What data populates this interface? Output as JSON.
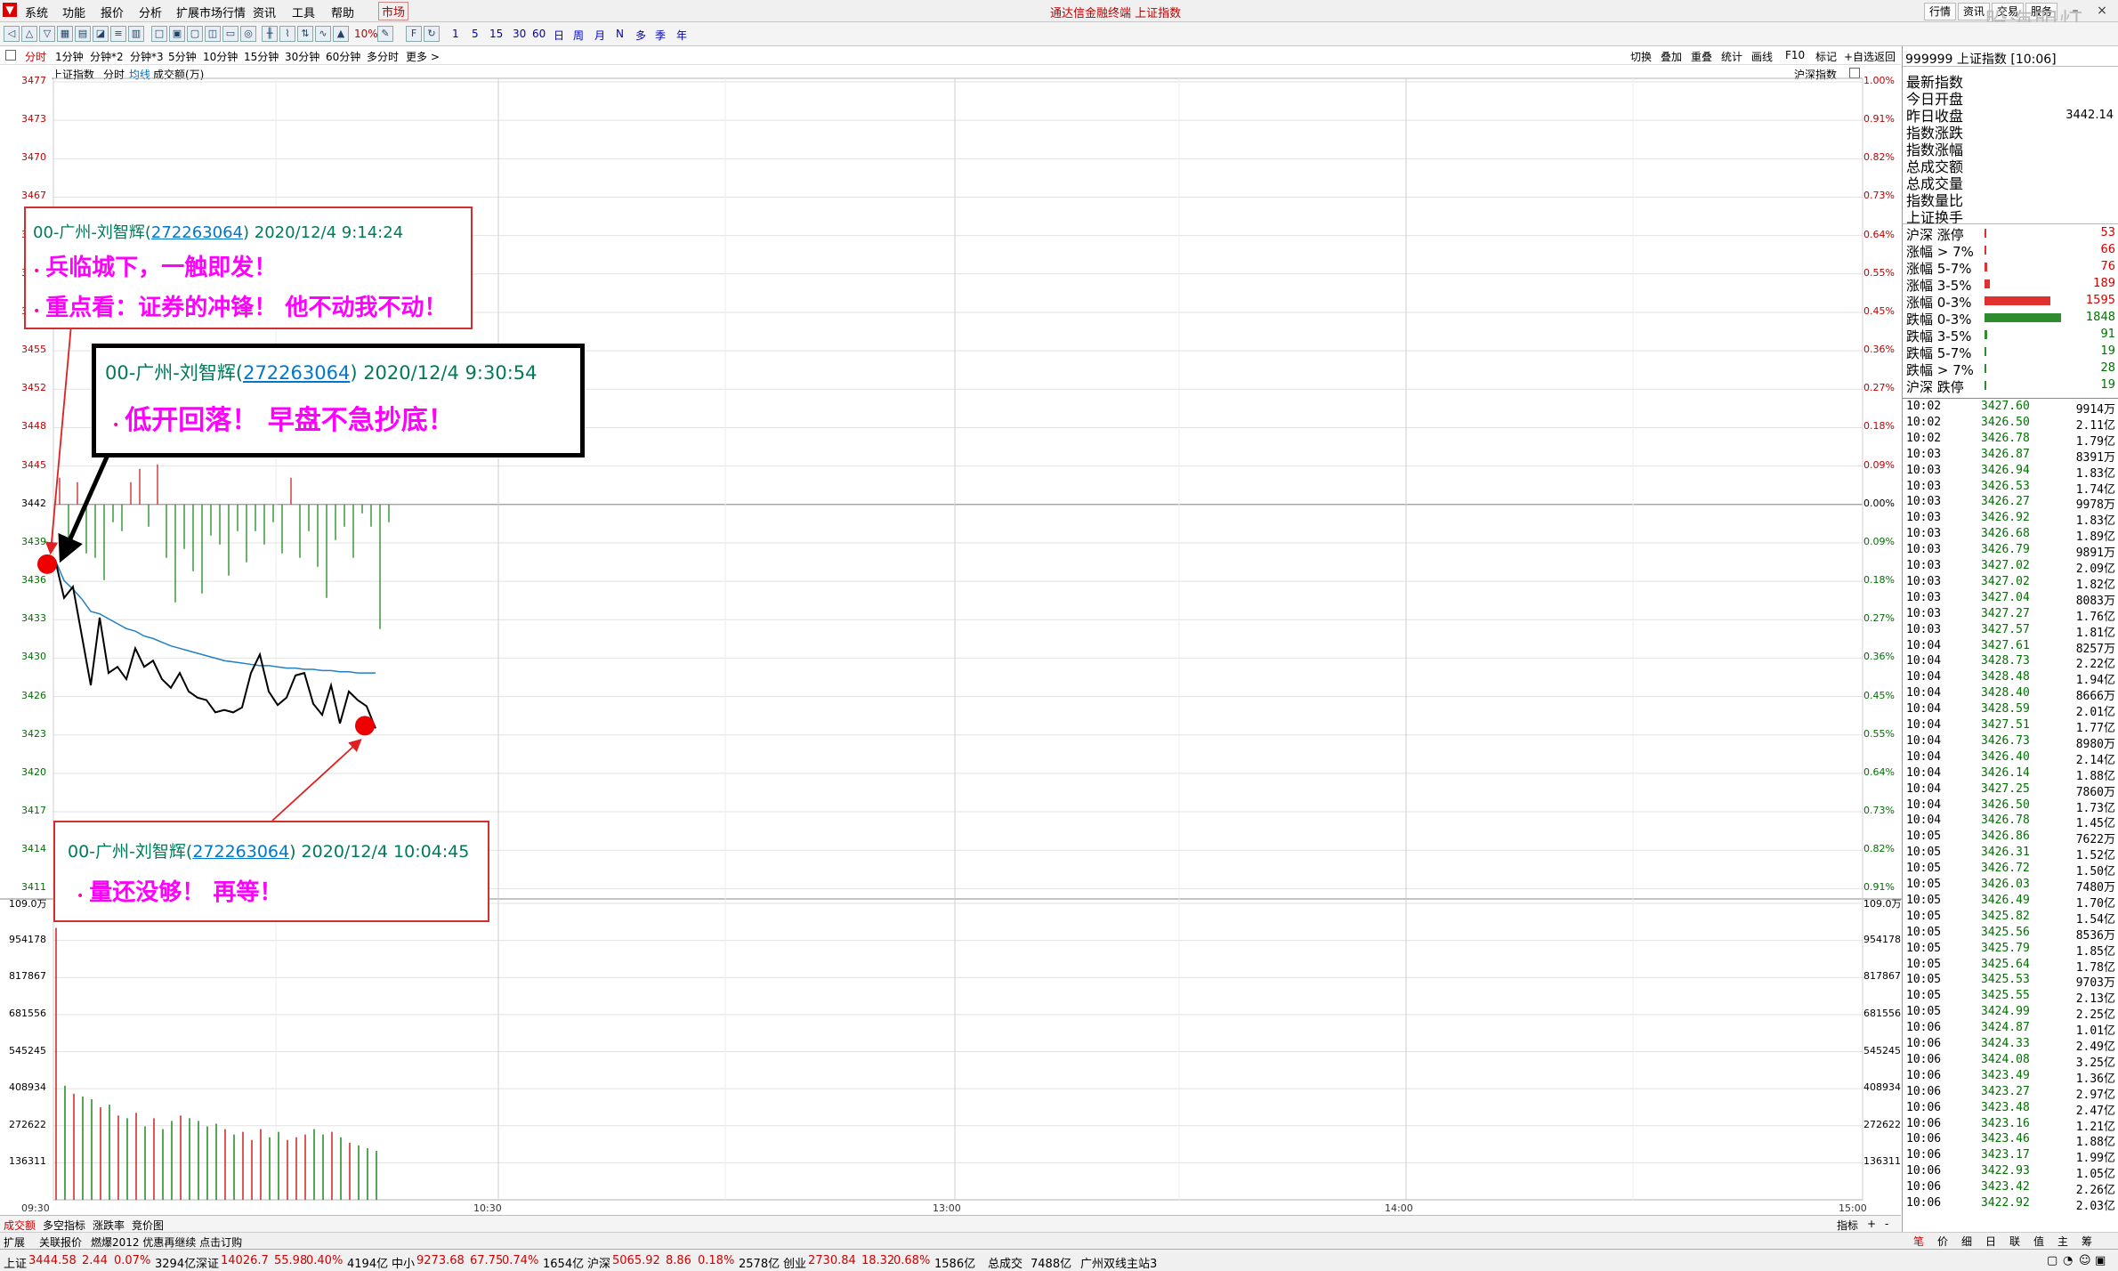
{
  "titlebar": {
    "menus": [
      "系统",
      "功能",
      "报价",
      "分析",
      "扩展市场行情",
      "资讯",
      "工具",
      "帮助"
    ],
    "market_tab": "市场",
    "title": "通达信金融终端 上证指数",
    "window_tabs": [
      "行情",
      "资讯",
      "交易",
      "服务"
    ],
    "watermark": "股海明灯"
  },
  "toolbar": {
    "zoom_label": "10%",
    "periods": [
      "1",
      "5",
      "15",
      "30",
      "60",
      "日",
      "周",
      "月",
      "N",
      "多",
      "季",
      "年"
    ]
  },
  "periodbar": {
    "items": [
      "分时",
      "1分钟",
      "分钟*2",
      "分钟*3",
      "5分钟",
      "10分钟",
      "15分钟",
      "30分钟",
      "60分钟",
      "多分时",
      "更多 >"
    ],
    "active": "分时",
    "right_tools": [
      "切换",
      "叠加",
      "重叠",
      "统计",
      "画线",
      "F10",
      "标记",
      "+自选",
      "返回"
    ]
  },
  "chart": {
    "sub_header": {
      "name": "上证指数",
      "mode": "分时",
      "avg": "均线",
      "volume_label": "成交额(万)",
      "right_label": "沪深指数"
    },
    "price_labels": [
      "3477",
      "3473",
      "3470",
      "3467",
      "3464",
      "3461",
      "3458",
      "3455",
      "3452",
      "3448",
      "3445",
      "3442",
      "3439",
      "3436",
      "3433",
      "3430",
      "3426",
      "3423",
      "3420",
      "3417",
      "3414",
      "3411"
    ],
    "pct_labels": [
      "1.00%",
      "0.91%",
      "0.82%",
      "0.73%",
      "0.64%",
      "0.55%",
      "0.45%",
      "0.36%",
      "0.27%",
      "0.18%",
      "0.09%",
      "0.00%",
      "0.09%",
      "0.18%",
      "0.27%",
      "0.36%",
      "0.45%",
      "0.55%",
      "0.64%",
      "0.73%",
      "0.82%",
      "0.91%"
    ],
    "vol_labels": [
      "109.0万",
      "954178",
      "817867",
      "681556",
      "545245",
      "408934",
      "272622",
      "136311"
    ],
    "time_labels": [
      "09:30",
      "10:30",
      "13:00",
      "14:00",
      "15:00"
    ]
  },
  "chart_data": {
    "type": "line",
    "title": "上证指数",
    "xlabel": "",
    "ylabel": "",
    "ylim": [
      3410,
      3477
    ],
    "prev_close": 3442.14,
    "x": [
      "09:30",
      "09:31",
      "09:32",
      "09:33",
      "09:34",
      "09:35",
      "09:36",
      "09:37",
      "09:38",
      "09:39",
      "09:40",
      "09:41",
      "09:42",
      "09:43",
      "09:44",
      "09:45",
      "09:46",
      "09:47",
      "09:48",
      "09:49",
      "09:50",
      "09:51",
      "09:52",
      "09:53",
      "09:54",
      "09:55",
      "09:56",
      "09:57",
      "09:58",
      "09:59",
      "10:00",
      "10:01",
      "10:02",
      "10:03",
      "10:04",
      "10:05",
      "10:06"
    ],
    "series": [
      {
        "name": "价格",
        "values": [
          3438.2,
          3435.1,
          3436.0,
          3432.0,
          3428.0,
          3433.5,
          3429.0,
          3429.5,
          3428.5,
          3431.0,
          3429.5,
          3430.0,
          3428.5,
          3427.8,
          3429.0,
          3427.5,
          3427.0,
          3426.8,
          3425.8,
          3426.0,
          3425.8,
          3426.2,
          3429.0,
          3430.5,
          3427.5,
          3426.4,
          3427.0,
          3428.8,
          3429.0,
          3426.5,
          3425.6,
          3428.0,
          3424.9,
          3427.5,
          3426.8,
          3426.3,
          3424.5
        ]
      },
      {
        "name": "均价",
        "values": [
          3438.2,
          3436.5,
          3435.8,
          3435.0,
          3434.0,
          3433.8,
          3433.4,
          3433.0,
          3432.6,
          3432.4,
          3432.0,
          3431.8,
          3431.5,
          3431.2,
          3431.0,
          3430.8,
          3430.6,
          3430.4,
          3430.2,
          3430.0,
          3429.9,
          3429.8,
          3429.7,
          3429.6,
          3429.6,
          3429.5,
          3429.4,
          3429.4,
          3429.3,
          3429.3,
          3429.2,
          3429.2,
          3429.1,
          3429.1,
          3429.0,
          3429.0,
          3429.0
        ]
      }
    ],
    "volume": [
      1000000,
      420000,
      390000,
      380000,
      370000,
      340000,
      350000,
      310000,
      300000,
      320000,
      270000,
      300000,
      260000,
      290000,
      310000,
      300000,
      290000,
      270000,
      280000,
      260000,
      240000,
      250000,
      220000,
      260000,
      230000,
      250000,
      220000,
      230000,
      240000,
      260000,
      240000,
      250000,
      230000,
      210000,
      200000,
      190000,
      180000
    ],
    "vol_ylim": [
      0,
      1090000
    ]
  },
  "annotations": [
    {
      "author": "00-广州-刘智辉(",
      "qq": "272263064",
      "time": ") 2020/12/4 9:14:24",
      "lines": [
        "兵临城下，一触即发！",
        "重点看：证券的冲锋！ 他不动我不动！"
      ]
    },
    {
      "author": "00-广州-刘智辉(",
      "qq": "272263064",
      "time": ") 2020/12/4 9:30:54",
      "lines": [
        "低开回落！ 早盘不急抄底！"
      ]
    },
    {
      "author": "00-广州-刘智辉(",
      "qq": "272263064",
      "time": ") 2020/12/4 10:04:45",
      "lines": [
        "量还没够！ 再等！"
      ]
    }
  ],
  "rpanel": {
    "code": "999999",
    "name": "上证指数",
    "clock": "[10:06]",
    "fields": [
      "最新指数",
      "今日开盘",
      "昨日收盘",
      "指数涨跌",
      "指数涨幅",
      "总成交额",
      "总成交量",
      "指数量比",
      "上证换手"
    ],
    "prev_close_value": "3442.14",
    "stats": [
      {
        "label": "沪深 涨停",
        "value": "53",
        "color": "#e03030",
        "frac": 0.02
      },
      {
        "label": "涨幅 > 7%",
        "value": "66",
        "color": "#e03030",
        "frac": 0.02
      },
      {
        "label": "涨幅 5-7%",
        "value": "76",
        "color": "#e03030",
        "frac": 0.03
      },
      {
        "label": "涨幅 3-5%",
        "value": "189",
        "color": "#e03030",
        "frac": 0.07
      },
      {
        "label": "涨幅 0-3%",
        "value": "1595",
        "color": "#e03030",
        "frac": 0.86
      },
      {
        "label": "跌幅 0-3%",
        "value": "1848",
        "color": "#2e8b2e",
        "frac": 1.0
      },
      {
        "label": "跌幅 3-5%",
        "value": "91",
        "color": "#2e8b2e",
        "frac": 0.03
      },
      {
        "label": "跌幅 5-7%",
        "value": "19",
        "color": "#2e8b2e",
        "frac": 0.01
      },
      {
        "label": "跌幅 > 7%",
        "value": "28",
        "color": "#2e8b2e",
        "frac": 0.01
      },
      {
        "label": "沪深 跌停",
        "value": "19",
        "color": "#2e8b2e",
        "frac": 0.01
      }
    ],
    "ticks": [
      [
        "10:02",
        "3427.60",
        "9914万"
      ],
      [
        "10:02",
        "3426.50",
        "2.11亿"
      ],
      [
        "10:02",
        "3426.78",
        "1.79亿"
      ],
      [
        "10:03",
        "3426.87",
        "8391万"
      ],
      [
        "10:03",
        "3426.94",
        "1.83亿"
      ],
      [
        "10:03",
        "3426.53",
        "1.74亿"
      ],
      [
        "10:03",
        "3426.27",
        "9978万"
      ],
      [
        "10:03",
        "3426.92",
        "1.83亿"
      ],
      [
        "10:03",
        "3426.68",
        "1.89亿"
      ],
      [
        "10:03",
        "3426.79",
        "9891万"
      ],
      [
        "10:03",
        "3427.02",
        "2.09亿"
      ],
      [
        "10:03",
        "3427.02",
        "1.82亿"
      ],
      [
        "10:03",
        "3427.04",
        "8083万"
      ],
      [
        "10:03",
        "3427.27",
        "1.76亿"
      ],
      [
        "10:03",
        "3427.57",
        "1.81亿"
      ],
      [
        "10:04",
        "3427.61",
        "8257万"
      ],
      [
        "10:04",
        "3428.73",
        "2.22亿"
      ],
      [
        "10:04",
        "3428.48",
        "1.94亿"
      ],
      [
        "10:04",
        "3428.40",
        "8666万"
      ],
      [
        "10:04",
        "3428.59",
        "2.01亿"
      ],
      [
        "10:04",
        "3427.51",
        "1.77亿"
      ],
      [
        "10:04",
        "3426.73",
        "8980万"
      ],
      [
        "10:04",
        "3426.40",
        "2.14亿"
      ],
      [
        "10:04",
        "3426.14",
        "1.88亿"
      ],
      [
        "10:04",
        "3427.25",
        "7860万"
      ],
      [
        "10:04",
        "3426.50",
        "1.73亿"
      ],
      [
        "10:04",
        "3426.78",
        "1.45亿"
      ],
      [
        "10:05",
        "3426.86",
        "7622万"
      ],
      [
        "10:05",
        "3426.31",
        "1.52亿"
      ],
      [
        "10:05",
        "3426.72",
        "1.50亿"
      ],
      [
        "10:05",
        "3426.03",
        "7480万"
      ],
      [
        "10:05",
        "3426.49",
        "1.70亿"
      ],
      [
        "10:05",
        "3425.82",
        "1.54亿"
      ],
      [
        "10:05",
        "3425.56",
        "8536万"
      ],
      [
        "10:05",
        "3425.79",
        "1.85亿"
      ],
      [
        "10:05",
        "3425.64",
        "1.78亿"
      ],
      [
        "10:05",
        "3425.53",
        "9703万"
      ],
      [
        "10:05",
        "3425.55",
        "2.13亿"
      ],
      [
        "10:05",
        "3424.99",
        "2.25亿"
      ],
      [
        "10:06",
        "3424.87",
        "1.01亿"
      ],
      [
        "10:06",
        "3424.33",
        "2.49亿"
      ],
      [
        "10:06",
        "3424.08",
        "3.25亿"
      ],
      [
        "10:06",
        "3423.49",
        "1.36亿"
      ],
      [
        "10:06",
        "3423.27",
        "2.97亿"
      ],
      [
        "10:06",
        "3423.48",
        "2.47亿"
      ],
      [
        "10:06",
        "3423.16",
        "1.21亿"
      ],
      [
        "10:06",
        "3423.46",
        "1.88亿"
      ],
      [
        "10:06",
        "3423.17",
        "1.99亿"
      ],
      [
        "10:06",
        "3422.93",
        "1.05亿"
      ],
      [
        "10:06",
        "3423.42",
        "2.26亿"
      ],
      [
        "10:06",
        "3422.92",
        "2.03亿"
      ]
    ],
    "bottom_tabs": [
      "笔",
      "价",
      "细",
      "日",
      "联",
      "值",
      "主",
      "筹"
    ]
  },
  "tabbar": {
    "tabs": [
      "成交额",
      "多空指标",
      "涨跌率",
      "竞价图"
    ],
    "active": "成交额",
    "right": "指标",
    "plus": "+",
    "minus": "-"
  },
  "newsbar": {
    "items": [
      "扩展",
      "关联报价",
      "燃爆2012 优惠再继续 点击订购"
    ]
  },
  "statusbar": {
    "items": [
      {
        "name": "上证",
        "vals": [
          "3444.58",
          "2.44",
          "0.07%"
        ],
        "amt": "3294亿"
      },
      {
        "name": "深证",
        "vals": [
          "14026.7",
          "55.98",
          "0.40%"
        ],
        "amt": "4194亿"
      },
      {
        "name": "中小",
        "vals": [
          "9273.68",
          "67.75",
          "0.74%"
        ],
        "amt": "1654亿"
      },
      {
        "name": "沪深",
        "vals": [
          "5065.92",
          "8.86",
          "0.18%"
        ],
        "amt": "2578亿"
      },
      {
        "name": "创业",
        "vals": [
          "2730.84",
          "18.32",
          "0.68%"
        ],
        "amt": "1586亿"
      }
    ],
    "total_label": "总成交",
    "total_value": "7488亿",
    "server": "广州双线主站3"
  }
}
